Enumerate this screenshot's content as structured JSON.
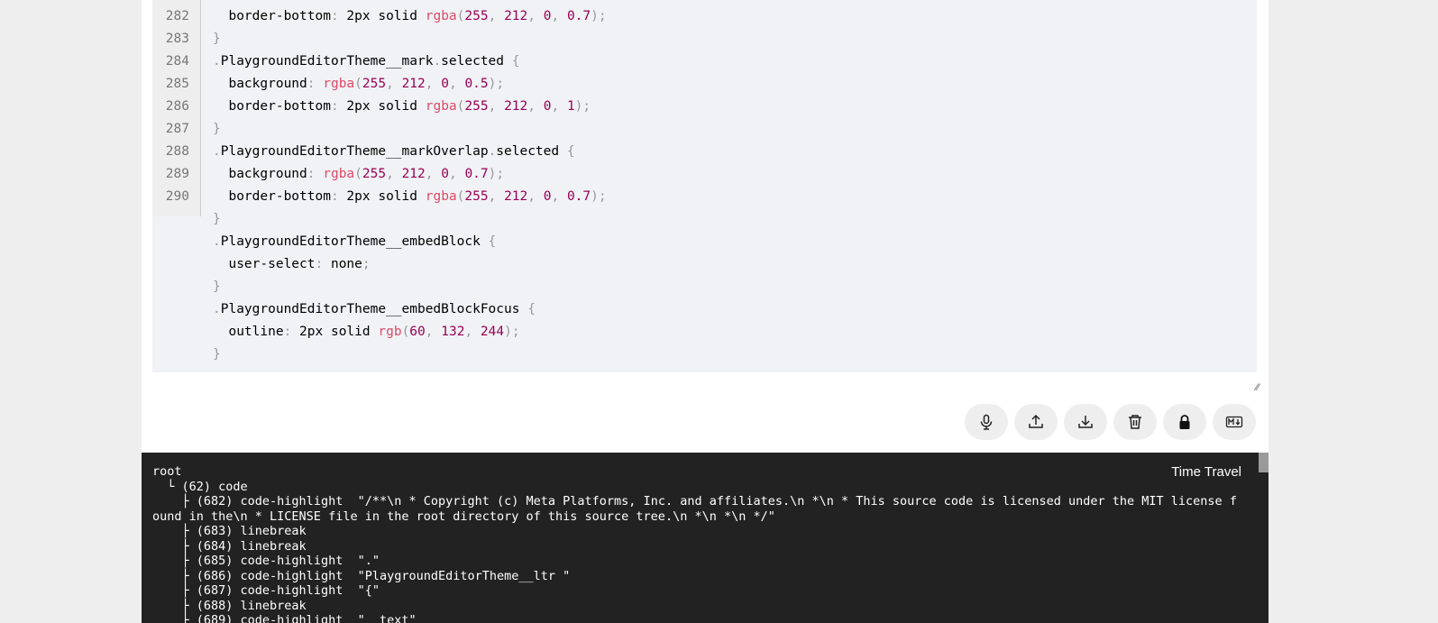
{
  "code_editor": {
    "lines": [
      {
        "num": "282",
        "tokens": [
          [
            "k-plain",
            "  border-bottom"
          ],
          [
            "k-punct",
            ": "
          ],
          [
            "k-plain",
            "2px solid "
          ],
          [
            "k-fn",
            "rgba"
          ],
          [
            "k-punct",
            "("
          ],
          [
            "k-num",
            "255"
          ],
          [
            "k-punct",
            ", "
          ],
          [
            "k-num",
            "212"
          ],
          [
            "k-punct",
            ", "
          ],
          [
            "k-num",
            "0"
          ],
          [
            "k-punct",
            ", "
          ],
          [
            "k-num",
            "0.7"
          ],
          [
            "k-punct",
            ");"
          ]
        ]
      },
      {
        "num": "283",
        "tokens": [
          [
            "k-punct",
            "}"
          ]
        ]
      },
      {
        "num": "284",
        "tokens": [
          [
            "k-punct",
            "."
          ],
          [
            "k-plain",
            "PlaygroundEditorTheme__mark"
          ],
          [
            "k-punct",
            "."
          ],
          [
            "k-plain",
            "selected "
          ],
          [
            "k-punct",
            "{"
          ]
        ]
      },
      {
        "num": "285",
        "tokens": [
          [
            "k-plain",
            "  background"
          ],
          [
            "k-punct",
            ": "
          ],
          [
            "k-fn",
            "rgba"
          ],
          [
            "k-punct",
            "("
          ],
          [
            "k-num",
            "255"
          ],
          [
            "k-punct",
            ", "
          ],
          [
            "k-num",
            "212"
          ],
          [
            "k-punct",
            ", "
          ],
          [
            "k-num",
            "0"
          ],
          [
            "k-punct",
            ", "
          ],
          [
            "k-num",
            "0.5"
          ],
          [
            "k-punct",
            ");"
          ]
        ]
      },
      {
        "num": "286",
        "tokens": [
          [
            "k-plain",
            "  border-bottom"
          ],
          [
            "k-punct",
            ": "
          ],
          [
            "k-plain",
            "2px solid "
          ],
          [
            "k-fn",
            "rgba"
          ],
          [
            "k-punct",
            "("
          ],
          [
            "k-num",
            "255"
          ],
          [
            "k-punct",
            ", "
          ],
          [
            "k-num",
            "212"
          ],
          [
            "k-punct",
            ", "
          ],
          [
            "k-num",
            "0"
          ],
          [
            "k-punct",
            ", "
          ],
          [
            "k-num",
            "1"
          ],
          [
            "k-punct",
            ");"
          ]
        ]
      },
      {
        "num": "287",
        "tokens": [
          [
            "k-punct",
            "}"
          ]
        ]
      },
      {
        "num": "288",
        "tokens": [
          [
            "k-punct",
            "."
          ],
          [
            "k-plain",
            "PlaygroundEditorTheme__markOverlap"
          ],
          [
            "k-punct",
            "."
          ],
          [
            "k-plain",
            "selected "
          ],
          [
            "k-punct",
            "{"
          ]
        ]
      },
      {
        "num": "289",
        "tokens": [
          [
            "k-plain",
            "  background"
          ],
          [
            "k-punct",
            ": "
          ],
          [
            "k-fn",
            "rgba"
          ],
          [
            "k-punct",
            "("
          ],
          [
            "k-num",
            "255"
          ],
          [
            "k-punct",
            ", "
          ],
          [
            "k-num",
            "212"
          ],
          [
            "k-punct",
            ", "
          ],
          [
            "k-num",
            "0"
          ],
          [
            "k-punct",
            ", "
          ],
          [
            "k-num",
            "0.7"
          ],
          [
            "k-punct",
            ");"
          ]
        ]
      },
      {
        "num": "290",
        "tokens": [
          [
            "k-plain",
            "  border-bottom"
          ],
          [
            "k-punct",
            ": "
          ],
          [
            "k-plain",
            "2px solid "
          ],
          [
            "k-fn",
            "rgba"
          ],
          [
            "k-punct",
            "("
          ],
          [
            "k-num",
            "255"
          ],
          [
            "k-punct",
            ", "
          ],
          [
            "k-num",
            "212"
          ],
          [
            "k-punct",
            ", "
          ],
          [
            "k-num",
            "0"
          ],
          [
            "k-punct",
            ", "
          ],
          [
            "k-num",
            "0.7"
          ],
          [
            "k-punct",
            ");"
          ]
        ]
      },
      {
        "num": "",
        "tokens": [
          [
            "k-punct",
            "}"
          ]
        ]
      },
      {
        "num": "",
        "tokens": [
          [
            "k-punct",
            "."
          ],
          [
            "k-plain",
            "PlaygroundEditorTheme__embedBlock "
          ],
          [
            "k-punct",
            "{"
          ]
        ]
      },
      {
        "num": "",
        "tokens": [
          [
            "k-plain",
            "  user-select"
          ],
          [
            "k-punct",
            ": "
          ],
          [
            "k-plain",
            "none"
          ],
          [
            "k-punct",
            ";"
          ]
        ]
      },
      {
        "num": "",
        "tokens": [
          [
            "k-punct",
            "}"
          ]
        ]
      },
      {
        "num": "",
        "tokens": [
          [
            "k-punct",
            "."
          ],
          [
            "k-plain",
            "PlaygroundEditorTheme__embedBlockFocus "
          ],
          [
            "k-punct",
            "{"
          ]
        ]
      },
      {
        "num": "",
        "tokens": [
          [
            "k-plain",
            "  outline"
          ],
          [
            "k-punct",
            ": "
          ],
          [
            "k-plain",
            "2px solid "
          ],
          [
            "k-fn",
            "rgb"
          ],
          [
            "k-punct",
            "("
          ],
          [
            "k-num",
            "60"
          ],
          [
            "k-punct",
            ", "
          ],
          [
            "k-num",
            "132"
          ],
          [
            "k-punct",
            ", "
          ],
          [
            "k-num",
            "244"
          ],
          [
            "k-punct",
            ");"
          ]
        ]
      },
      {
        "num": "",
        "tokens": [
          [
            "k-punct",
            "}"
          ]
        ]
      }
    ]
  },
  "toolbar": {
    "buttons": [
      {
        "name": "speech-to-text-button",
        "icon": "microphone-icon"
      },
      {
        "name": "import-button",
        "icon": "upload-icon"
      },
      {
        "name": "export-button",
        "icon": "download-icon"
      },
      {
        "name": "clear-button",
        "icon": "trash-icon"
      },
      {
        "name": "lock-button",
        "icon": "lock-icon"
      },
      {
        "name": "markdown-button",
        "icon": "markdown-icon"
      }
    ]
  },
  "tree_view": {
    "time_travel_label": "Time Travel",
    "text": "root\n  └ (62) code\n    ├ (682) code-highlight  \"/**\\n * Copyright (c) Meta Platforms, Inc. and affiliates.\\n *\\n * This source code is licensed under the MIT license found in the\\n * LICENSE file in the root directory of this source tree.\\n *\\n *\\n */\"\n    ├ (683) linebreak\n    ├ (684) linebreak\n    ├ (685) code-highlight  \".\"\n    ├ (686) code-highlight  \"PlaygroundEditorTheme__ltr \"\n    ├ (687) code-highlight  \"{\"\n    ├ (688) linebreak\n    ├ (689) code-highlight  \"  text\""
  },
  "colors": {
    "code_bg": "#f0f2f5",
    "tree_bg": "#222222",
    "fn": "#dd4a68",
    "num": "#990055",
    "punct": "#999999"
  }
}
